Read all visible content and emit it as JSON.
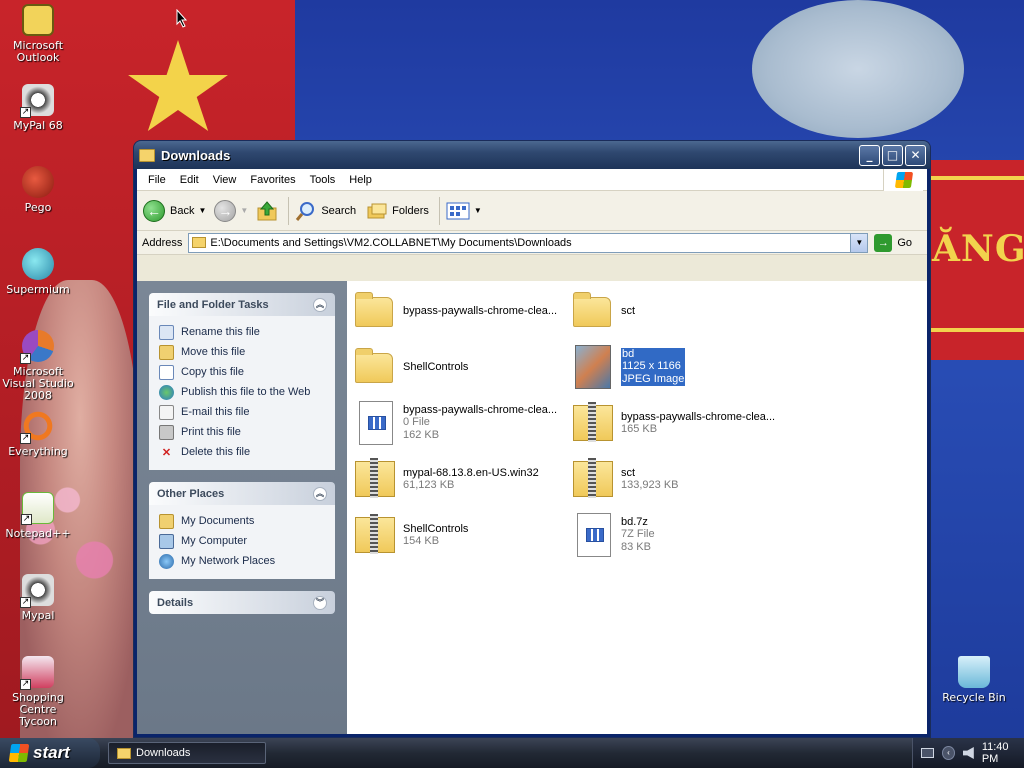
{
  "desktop": {
    "banner_text": "ĂNG",
    "icons": [
      {
        "label": "Microsoft Outlook",
        "icon": "outlook-icon",
        "color": "#f2d35a"
      },
      {
        "label": "MyPal 68",
        "icon": "mypal-icon",
        "color": "#d8d8d8"
      },
      {
        "label": "Pego",
        "icon": "pego-icon",
        "color": "#b0281e"
      },
      {
        "label": "Supermium",
        "icon": "supermium-icon",
        "color": "#40a8c8"
      },
      {
        "label": "Microsoft Visual Studio 2008",
        "icon": "visual-studio-icon",
        "color": "#e87a2a"
      },
      {
        "label": "Everything",
        "icon": "everything-icon",
        "color": "#f07820"
      },
      {
        "label": "Notepad++",
        "icon": "notepadpp-icon",
        "color": "#6ab83a"
      },
      {
        "label": "Mypal",
        "icon": "mypal-icon",
        "color": "#d8d8d8"
      },
      {
        "label": "Shopping Centre Tycoon",
        "icon": "shopping-tycoon-icon",
        "color": "#d04060"
      },
      {
        "label": "Recycle Bin",
        "icon": "recycle-bin-icon",
        "color": "#8ac8e8"
      }
    ]
  },
  "window": {
    "title": "Downloads",
    "menu": [
      "File",
      "Edit",
      "View",
      "Favorites",
      "Tools",
      "Help"
    ],
    "toolbar": {
      "back": "Back",
      "search": "Search",
      "folders": "Folders"
    },
    "address": {
      "label": "Address",
      "value": "E:\\Documents and Settings\\VM2.COLLABNET\\My Documents\\Downloads",
      "go": "Go"
    },
    "tasks_panel": {
      "title": "File and Folder Tasks",
      "items": [
        {
          "label": "Rename this file",
          "icon": "rename-icon"
        },
        {
          "label": "Move this file",
          "icon": "move-icon"
        },
        {
          "label": "Copy this file",
          "icon": "copy-icon"
        },
        {
          "label": "Publish this file to the Web",
          "icon": "publish-web-icon"
        },
        {
          "label": "E-mail this file",
          "icon": "email-icon"
        },
        {
          "label": "Print this file",
          "icon": "print-icon"
        },
        {
          "label": "Delete this file",
          "icon": "delete-icon"
        }
      ]
    },
    "places_panel": {
      "title": "Other Places",
      "items": [
        {
          "label": "My Documents",
          "icon": "my-documents-icon"
        },
        {
          "label": "My Computer",
          "icon": "my-computer-icon"
        },
        {
          "label": "My Network Places",
          "icon": "network-places-icon"
        }
      ]
    },
    "details_panel": {
      "title": "Details"
    },
    "files": [
      {
        "name": "bypass-paywalls-chrome-clea...",
        "type": "folder",
        "line2": "",
        "line3": ""
      },
      {
        "name": "sct",
        "type": "folder",
        "line2": "",
        "line3": ""
      },
      {
        "name": "ShellControls",
        "type": "folder",
        "line2": "",
        "line3": ""
      },
      {
        "name": "bd",
        "type": "image",
        "line2": "1125 x 1166",
        "line3": "JPEG Image",
        "selected": true
      },
      {
        "name": "bypass-paywalls-chrome-clea...",
        "type": "file",
        "line2": "0 File",
        "line3": "162 KB"
      },
      {
        "name": "bypass-paywalls-chrome-clea...",
        "type": "zip",
        "line2": "165 KB",
        "line3": ""
      },
      {
        "name": "mypal-68.13.8.en-US.win32",
        "type": "zip",
        "line2": "61,123 KB",
        "line3": ""
      },
      {
        "name": "sct",
        "type": "zip",
        "line2": "133,923 KB",
        "line3": ""
      },
      {
        "name": "ShellControls",
        "type": "zip",
        "line2": "154 KB",
        "line3": ""
      },
      {
        "name": "bd.7z",
        "type": "file",
        "line2": "7Z File",
        "line3": "83 KB"
      }
    ]
  },
  "taskbar": {
    "start": "start",
    "task": "Downloads",
    "clock": "11:40 PM"
  }
}
